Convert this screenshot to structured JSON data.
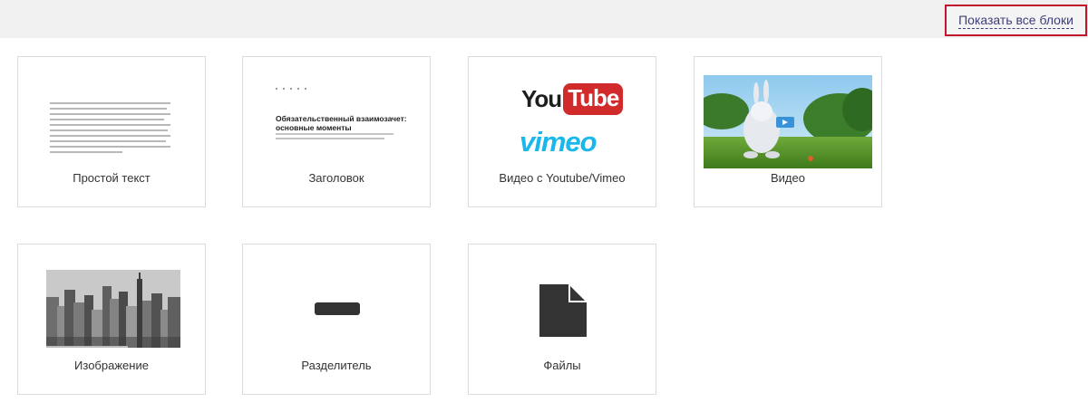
{
  "toolbar": {
    "show_all_label": "Показать все блоки"
  },
  "blocks": [
    {
      "label": "Простой текст"
    },
    {
      "label": "Заголовок",
      "preview_title": "Обязательственный взаимозачет: основные моменты"
    },
    {
      "label": "Видео с Youtube/Vimeo",
      "logo_youtube": "You",
      "logo_tube": "Tube",
      "logo_vimeo": "vimeo"
    },
    {
      "label": "Видео"
    },
    {
      "label": "Изображение"
    },
    {
      "label": "Разделитель"
    },
    {
      "label": "Файлы"
    }
  ],
  "colors": {
    "accent_border": "#c0152a",
    "link": "#3d3d7a",
    "youtube_red": "#d12a2a",
    "vimeo_blue": "#1ab7ea"
  }
}
